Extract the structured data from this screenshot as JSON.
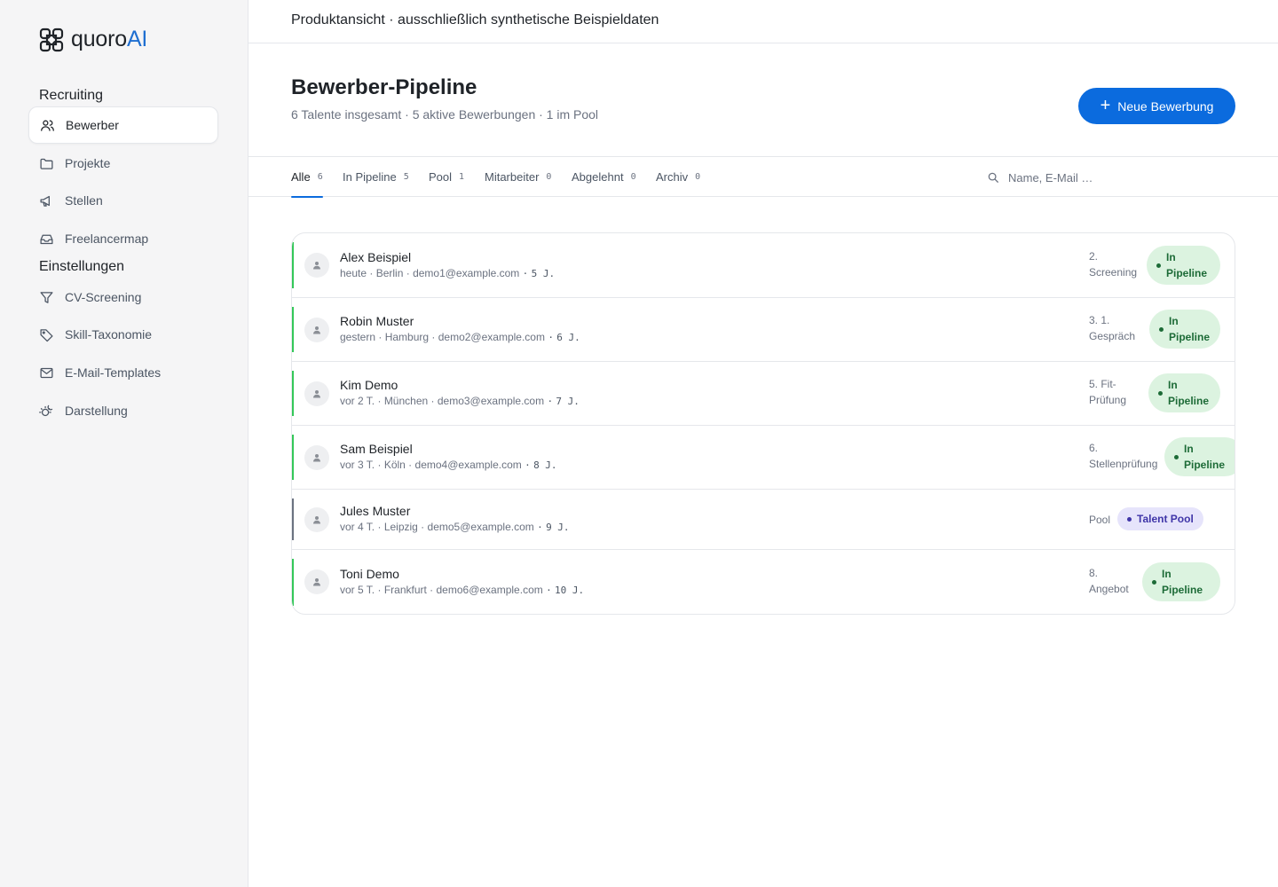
{
  "brand": {
    "name_main": "quoro",
    "name_accent": "AI",
    "accent_color": "#1f6fd1"
  },
  "sidebar": {
    "section_recruiting": "Recruiting",
    "section_settings": "Einstellungen",
    "items": [
      {
        "label": "Bewerber",
        "icon": "users-icon",
        "active": true
      },
      {
        "label": "Projekte",
        "icon": "folder-icon"
      },
      {
        "label": "Stellen",
        "icon": "megaphone-icon"
      },
      {
        "label": "Freelancermap",
        "icon": "inbox-icon"
      },
      {
        "label": "CV-Screening",
        "icon": "filter-icon"
      },
      {
        "label": "Skill-Taxonomie",
        "icon": "tag-icon"
      },
      {
        "label": "E-Mail-Templates",
        "icon": "mail-icon"
      },
      {
        "label": "Darstellung",
        "icon": "sun-moon-icon"
      }
    ]
  },
  "topbar": {
    "text": "Produktansicht · ausschließlich synthetische Beispieldaten"
  },
  "header": {
    "title": "Bewerber-Pipeline",
    "subtitle": "6 Talente insgesamt · 5 aktive Bewerbungen · 1 im Pool",
    "new_button": "Neue Bewerbung",
    "primary_color": "#0b6bde"
  },
  "tabs": [
    {
      "label": "Alle",
      "count": "6",
      "active": true
    },
    {
      "label": "In Pipeline",
      "count": "5"
    },
    {
      "label": "Pool",
      "count": "1"
    },
    {
      "label": "Mitarbeiter",
      "count": "0"
    },
    {
      "label": "Abgelehnt",
      "count": "0"
    },
    {
      "label": "Archiv",
      "count": "0"
    }
  ],
  "search": {
    "placeholder": "Name, E-Mail …"
  },
  "candidates": [
    {
      "name": "Alex Beispiel",
      "when": "heute",
      "city": "Berlin",
      "email": "demo1@example.com",
      "experience": "5 J.",
      "stage_line1": "2.",
      "stage_line2": "Screening",
      "status_line1": "In",
      "status_line2": "Pipeline",
      "accent": "#34c759"
    },
    {
      "name": "Robin Muster",
      "when": "gestern",
      "city": "Hamburg",
      "email": "demo2@example.com",
      "experience": "6 J.",
      "stage_line1": "3. 1.",
      "stage_line2": "Gespräch",
      "status_line1": "In",
      "status_line2": "Pipeline",
      "accent": "#34c759"
    },
    {
      "name": "Kim Demo",
      "when": "vor 2 T.",
      "city": "München",
      "email": "demo3@example.com",
      "experience": "7 J.",
      "stage_line1": "5. Fit-",
      "stage_line2": "Prüfung",
      "status_line1": "In",
      "status_line2": "Pipeline",
      "accent": "#34c759"
    },
    {
      "name": "Sam Beispiel",
      "when": "vor 3 T.",
      "city": "Köln",
      "email": "demo4@example.com",
      "experience": "8 J.",
      "stage_line1": "6.",
      "stage_line2": "Stellenprüfung",
      "status_line1": "In",
      "status_line2": "Pipeline",
      "accent": "#34c759"
    },
    {
      "name": "Jules Muster",
      "when": "vor 4 T.",
      "city": "Leipzig",
      "email": "demo5@example.com",
      "experience": "9 J.",
      "stage_line1": "Pool",
      "stage_line2": "",
      "status": "Talent Pool",
      "accent": "#6b7280"
    },
    {
      "name": "Toni Demo",
      "when": "vor 5 T.",
      "city": "Frankfurt",
      "email": "demo6@example.com",
      "experience": "10 J.",
      "stage_line1": "8.",
      "stage_line2": "Angebot",
      "status_line1": "In",
      "status_line2": "Pipeline",
      "accent": "#34c759"
    }
  ]
}
